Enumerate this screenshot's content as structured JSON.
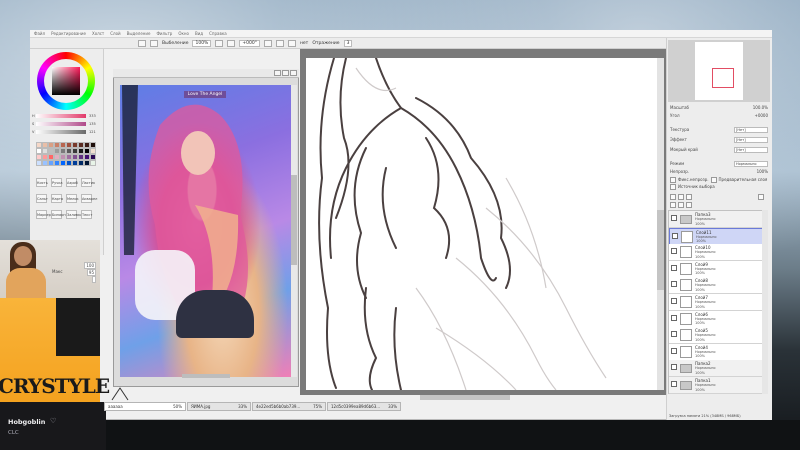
{
  "menubar": {
    "items": [
      "Файл",
      "Редактирование",
      "Холст",
      "Слой",
      "Выделение",
      "Фильтр",
      "Окно",
      "Вид",
      "Справка"
    ]
  },
  "toolbar": {
    "selection_label": "Выбеление",
    "zoom": "100%",
    "angle": "+000°",
    "stabilizer_label": "Отражение",
    "stabilizer_value": "3",
    "mode": "нет"
  },
  "color": {
    "sliders": [
      {
        "label": "H",
        "value": "333",
        "color": "#e23a6a"
      },
      {
        "label": "S",
        "value": "135",
        "color": "#b04a8a"
      },
      {
        "label": "V",
        "value": "121",
        "color": "#6a6a6a"
      }
    ],
    "swatches": [
      "#f5d7c7",
      "#e9bfa8",
      "#d99f84",
      "#c98068",
      "#b86650",
      "#a0503e",
      "#7a3a2c",
      "#5a2a20",
      "#3c1c16",
      "#1e0e0a",
      "#ffffff",
      "#dedede",
      "#bdbdbd",
      "#9c9c9c",
      "#7b7b7b",
      "#5a5a5a",
      "#393939",
      "#181818",
      "#000000",
      "#f0e0d0",
      "#ffcccc",
      "#ff9999",
      "#ff6666",
      "#e0b0c0",
      "#c090b0",
      "#a070a0",
      "#805090",
      "#603080",
      "#401070",
      "#2a0a55",
      "#cce0ff",
      "#99c2ff",
      "#66a3ff",
      "#3385ff",
      "#0066ff",
      "#0052cc",
      "#003d99",
      "#002966",
      "#001433",
      "#e8f4e8"
    ]
  },
  "tools": [
    "Кисть",
    "Ручка",
    "Аэроб",
    "Ластик",
    "Сальт",
    "Карта",
    "Мелок",
    "Акварел",
    "Маркер",
    "Бинарн",
    "Заливка",
    "Текст"
  ],
  "webcam": {
    "stats": [
      {
        "label": "",
        "value": "100"
      },
      {
        "label": "Макс",
        "value": "95"
      },
      {
        "label": "",
        "value": ""
      }
    ]
  },
  "banner": {
    "text": "CRYSTYLE"
  },
  "stream": {
    "streamer": "Hobgoblin",
    "category": "CLC"
  },
  "reference": {
    "caption": "Love The Angel"
  },
  "tabs": [
    {
      "name": "аааааа",
      "zoom": "50%"
    },
    {
      "name": "ЯИМА.jpg",
      "zoom": "33%"
    },
    {
      "name": "4e22ed5b6b0ab739...",
      "zoom": "75%"
    },
    {
      "name": "12d5c0399ea89d6b63...",
      "zoom": "33%"
    }
  ],
  "right": {
    "zoom_label": "Масштаб",
    "zoom_value": "100.0%",
    "angle_label": "Угол",
    "angle_value": "+0000",
    "texture_label": "Текстура",
    "texture_value": "[Нет]",
    "effect_label": "Эффект",
    "effect_value": "[Нет]",
    "edge_label": "Мокрый край",
    "edge_value": "[Нет]",
    "blend_label": "Режим",
    "blend_value": "Нормально",
    "opacity_label": "Непрозр.",
    "opacity_value": "100%",
    "check1": "Фикс.непрозр.",
    "check2": "Предварительная слоя",
    "check3": "Источник выбора"
  },
  "layers": [
    {
      "name": "Папка3",
      "mode": "Нормально",
      "opacity": "100%",
      "folder": true,
      "selected": false
    },
    {
      "name": "Слой11",
      "mode": "Нормально",
      "opacity": "100%",
      "folder": false,
      "selected": true
    },
    {
      "name": "Слой10",
      "mode": "Нормально",
      "opacity": "100%",
      "folder": false,
      "selected": false
    },
    {
      "name": "Слой9",
      "mode": "Нормально",
      "opacity": "100%",
      "folder": false,
      "selected": false
    },
    {
      "name": "Слой8",
      "mode": "Нормально",
      "opacity": "100%",
      "folder": false,
      "selected": false
    },
    {
      "name": "Слой7",
      "mode": "Нормально",
      "opacity": "100%",
      "folder": false,
      "selected": false
    },
    {
      "name": "Слой6",
      "mode": "Нормально",
      "opacity": "100%",
      "folder": false,
      "selected": false
    },
    {
      "name": "Слой5",
      "mode": "Нормально",
      "opacity": "100%",
      "folder": false,
      "selected": false
    },
    {
      "name": "Слой4",
      "mode": "Нормально",
      "opacity": "100%",
      "folder": false,
      "selected": false
    },
    {
      "name": "Папка2",
      "mode": "Нормально",
      "opacity": "100%",
      "folder": true,
      "selected": false
    },
    {
      "name": "Папка1",
      "mode": "Нормально",
      "opacity": "100%",
      "folder": true,
      "selected": false
    }
  ],
  "status": {
    "memory": "Загрузка памяти 21% (348МБ / 968МБ)"
  }
}
